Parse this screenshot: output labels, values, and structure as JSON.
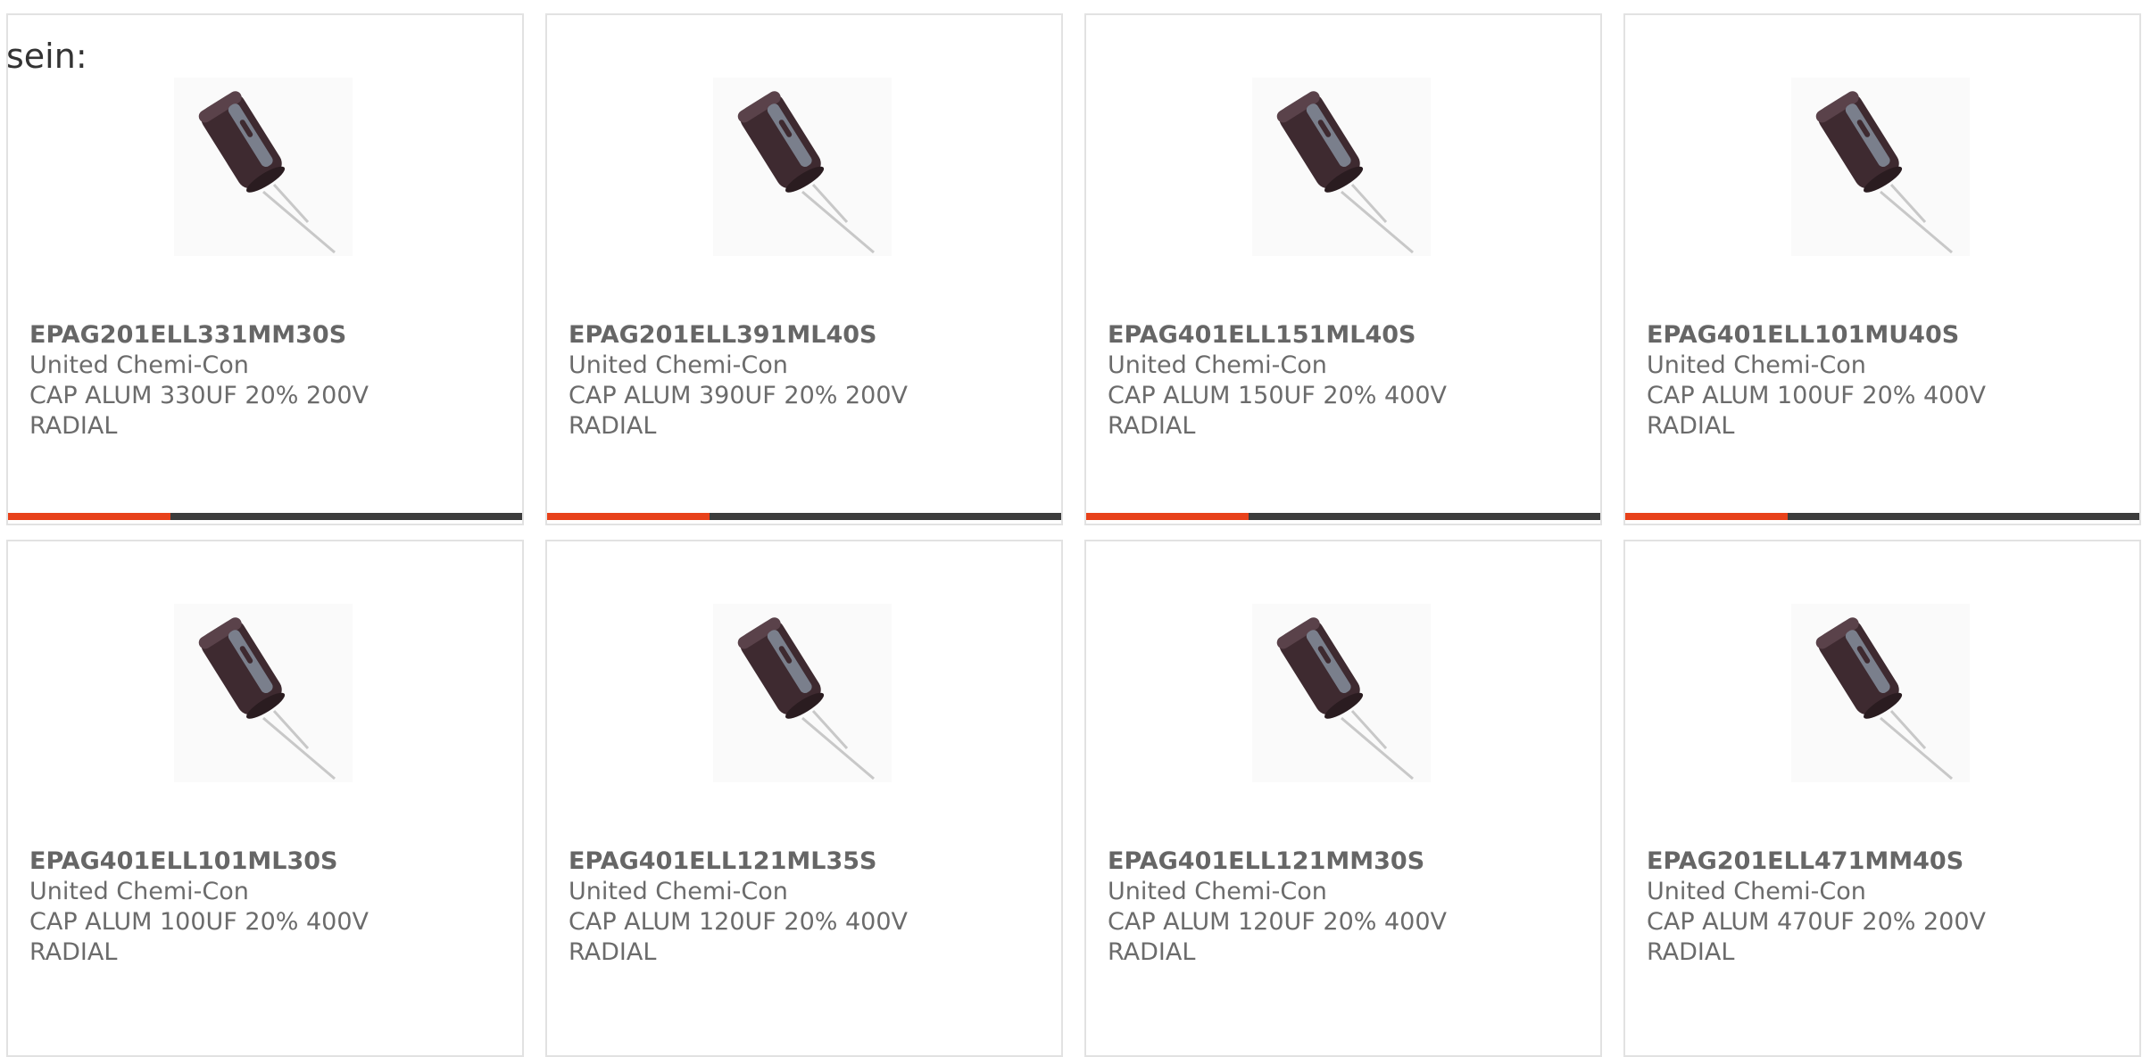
{
  "intro_text": "sein:",
  "colors": {
    "accent": "#e8411a",
    "bar_dark": "#3c3c3c",
    "text": "#6b6b6b",
    "border": "#e2e2e2"
  },
  "products": [
    {
      "part_number": "EPAG201ELL331MM30S",
      "manufacturer": "United Chemi-Con",
      "description": "CAP ALUM 330UF 20% 200V",
      "package": "RADIAL",
      "image_icon": "capacitor-image"
    },
    {
      "part_number": "EPAG201ELL391ML40S",
      "manufacturer": "United Chemi-Con",
      "description": "CAP ALUM 390UF 20% 200V",
      "package": "RADIAL",
      "image_icon": "capacitor-image"
    },
    {
      "part_number": "EPAG401ELL151ML40S",
      "manufacturer": "United Chemi-Con",
      "description": "CAP ALUM 150UF 20% 400V",
      "package": "RADIAL",
      "image_icon": "capacitor-image"
    },
    {
      "part_number": "EPAG401ELL101MU40S",
      "manufacturer": "United Chemi-Con",
      "description": "CAP ALUM 100UF 20% 400V",
      "package": "RADIAL",
      "image_icon": "capacitor-image"
    },
    {
      "part_number": "EPAG401ELL101ML30S",
      "manufacturer": "United Chemi-Con",
      "description": "CAP ALUM 100UF 20% 400V",
      "package": "RADIAL",
      "image_icon": "capacitor-image"
    },
    {
      "part_number": "EPAG401ELL121ML35S",
      "manufacturer": "United Chemi-Con",
      "description": "CAP ALUM 120UF 20% 400V",
      "package": "RADIAL",
      "image_icon": "capacitor-image"
    },
    {
      "part_number": "EPAG401ELL121MM30S",
      "manufacturer": "United Chemi-Con",
      "description": "CAP ALUM 120UF 20% 400V",
      "package": "RADIAL",
      "image_icon": "capacitor-image"
    },
    {
      "part_number": "EPAG201ELL471MM40S",
      "manufacturer": "United Chemi-Con",
      "description": "CAP ALUM 470UF 20% 200V",
      "package": "RADIAL",
      "image_icon": "capacitor-image"
    }
  ]
}
